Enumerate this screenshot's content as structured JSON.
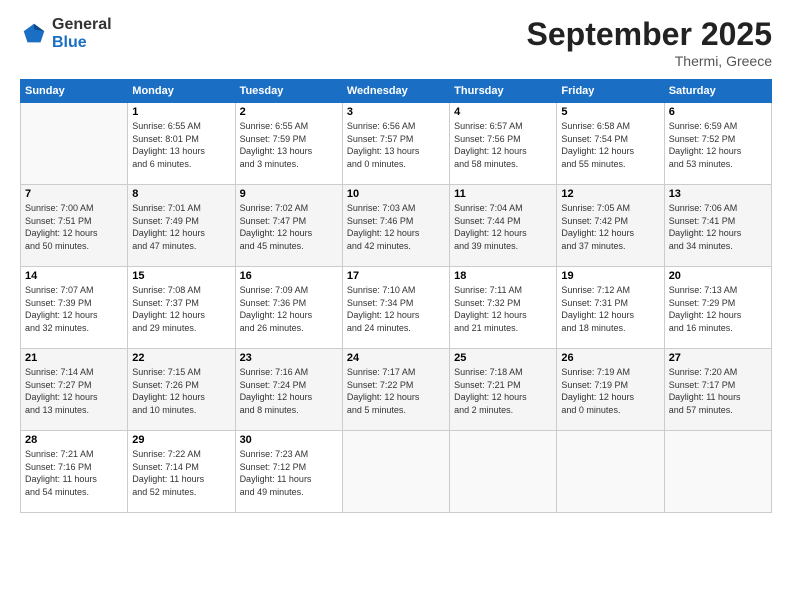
{
  "header": {
    "logo_general": "General",
    "logo_blue": "Blue",
    "month_title": "September 2025",
    "location": "Thermi, Greece"
  },
  "days_of_week": [
    "Sunday",
    "Monday",
    "Tuesday",
    "Wednesday",
    "Thursday",
    "Friday",
    "Saturday"
  ],
  "weeks": [
    [
      {
        "day": "",
        "info": ""
      },
      {
        "day": "1",
        "info": "Sunrise: 6:55 AM\nSunset: 8:01 PM\nDaylight: 13 hours\nand 6 minutes."
      },
      {
        "day": "2",
        "info": "Sunrise: 6:55 AM\nSunset: 7:59 PM\nDaylight: 13 hours\nand 3 minutes."
      },
      {
        "day": "3",
        "info": "Sunrise: 6:56 AM\nSunset: 7:57 PM\nDaylight: 13 hours\nand 0 minutes."
      },
      {
        "day": "4",
        "info": "Sunrise: 6:57 AM\nSunset: 7:56 PM\nDaylight: 12 hours\nand 58 minutes."
      },
      {
        "day": "5",
        "info": "Sunrise: 6:58 AM\nSunset: 7:54 PM\nDaylight: 12 hours\nand 55 minutes."
      },
      {
        "day": "6",
        "info": "Sunrise: 6:59 AM\nSunset: 7:52 PM\nDaylight: 12 hours\nand 53 minutes."
      }
    ],
    [
      {
        "day": "7",
        "info": "Sunrise: 7:00 AM\nSunset: 7:51 PM\nDaylight: 12 hours\nand 50 minutes."
      },
      {
        "day": "8",
        "info": "Sunrise: 7:01 AM\nSunset: 7:49 PM\nDaylight: 12 hours\nand 47 minutes."
      },
      {
        "day": "9",
        "info": "Sunrise: 7:02 AM\nSunset: 7:47 PM\nDaylight: 12 hours\nand 45 minutes."
      },
      {
        "day": "10",
        "info": "Sunrise: 7:03 AM\nSunset: 7:46 PM\nDaylight: 12 hours\nand 42 minutes."
      },
      {
        "day": "11",
        "info": "Sunrise: 7:04 AM\nSunset: 7:44 PM\nDaylight: 12 hours\nand 39 minutes."
      },
      {
        "day": "12",
        "info": "Sunrise: 7:05 AM\nSunset: 7:42 PM\nDaylight: 12 hours\nand 37 minutes."
      },
      {
        "day": "13",
        "info": "Sunrise: 7:06 AM\nSunset: 7:41 PM\nDaylight: 12 hours\nand 34 minutes."
      }
    ],
    [
      {
        "day": "14",
        "info": "Sunrise: 7:07 AM\nSunset: 7:39 PM\nDaylight: 12 hours\nand 32 minutes."
      },
      {
        "day": "15",
        "info": "Sunrise: 7:08 AM\nSunset: 7:37 PM\nDaylight: 12 hours\nand 29 minutes."
      },
      {
        "day": "16",
        "info": "Sunrise: 7:09 AM\nSunset: 7:36 PM\nDaylight: 12 hours\nand 26 minutes."
      },
      {
        "day": "17",
        "info": "Sunrise: 7:10 AM\nSunset: 7:34 PM\nDaylight: 12 hours\nand 24 minutes."
      },
      {
        "day": "18",
        "info": "Sunrise: 7:11 AM\nSunset: 7:32 PM\nDaylight: 12 hours\nand 21 minutes."
      },
      {
        "day": "19",
        "info": "Sunrise: 7:12 AM\nSunset: 7:31 PM\nDaylight: 12 hours\nand 18 minutes."
      },
      {
        "day": "20",
        "info": "Sunrise: 7:13 AM\nSunset: 7:29 PM\nDaylight: 12 hours\nand 16 minutes."
      }
    ],
    [
      {
        "day": "21",
        "info": "Sunrise: 7:14 AM\nSunset: 7:27 PM\nDaylight: 12 hours\nand 13 minutes."
      },
      {
        "day": "22",
        "info": "Sunrise: 7:15 AM\nSunset: 7:26 PM\nDaylight: 12 hours\nand 10 minutes."
      },
      {
        "day": "23",
        "info": "Sunrise: 7:16 AM\nSunset: 7:24 PM\nDaylight: 12 hours\nand 8 minutes."
      },
      {
        "day": "24",
        "info": "Sunrise: 7:17 AM\nSunset: 7:22 PM\nDaylight: 12 hours\nand 5 minutes."
      },
      {
        "day": "25",
        "info": "Sunrise: 7:18 AM\nSunset: 7:21 PM\nDaylight: 12 hours\nand 2 minutes."
      },
      {
        "day": "26",
        "info": "Sunrise: 7:19 AM\nSunset: 7:19 PM\nDaylight: 12 hours\nand 0 minutes."
      },
      {
        "day": "27",
        "info": "Sunrise: 7:20 AM\nSunset: 7:17 PM\nDaylight: 11 hours\nand 57 minutes."
      }
    ],
    [
      {
        "day": "28",
        "info": "Sunrise: 7:21 AM\nSunset: 7:16 PM\nDaylight: 11 hours\nand 54 minutes."
      },
      {
        "day": "29",
        "info": "Sunrise: 7:22 AM\nSunset: 7:14 PM\nDaylight: 11 hours\nand 52 minutes."
      },
      {
        "day": "30",
        "info": "Sunrise: 7:23 AM\nSunset: 7:12 PM\nDaylight: 11 hours\nand 49 minutes."
      },
      {
        "day": "",
        "info": ""
      },
      {
        "day": "",
        "info": ""
      },
      {
        "day": "",
        "info": ""
      },
      {
        "day": "",
        "info": ""
      }
    ]
  ]
}
